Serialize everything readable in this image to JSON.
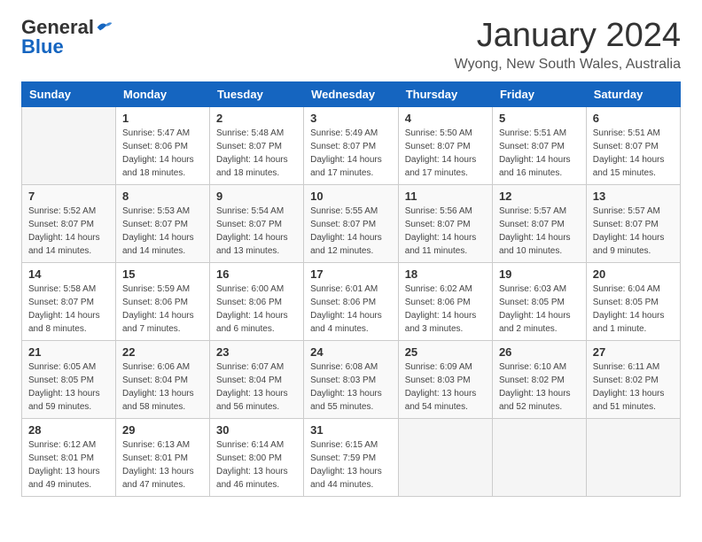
{
  "header": {
    "logo_general": "General",
    "logo_blue": "Blue",
    "month_title": "January 2024",
    "location": "Wyong, New South Wales, Australia"
  },
  "weekdays": [
    "Sunday",
    "Monday",
    "Tuesday",
    "Wednesday",
    "Thursday",
    "Friday",
    "Saturday"
  ],
  "weeks": [
    [
      {
        "day": "",
        "info": ""
      },
      {
        "day": "1",
        "info": "Sunrise: 5:47 AM\nSunset: 8:06 PM\nDaylight: 14 hours\nand 18 minutes."
      },
      {
        "day": "2",
        "info": "Sunrise: 5:48 AM\nSunset: 8:07 PM\nDaylight: 14 hours\nand 18 minutes."
      },
      {
        "day": "3",
        "info": "Sunrise: 5:49 AM\nSunset: 8:07 PM\nDaylight: 14 hours\nand 17 minutes."
      },
      {
        "day": "4",
        "info": "Sunrise: 5:50 AM\nSunset: 8:07 PM\nDaylight: 14 hours\nand 17 minutes."
      },
      {
        "day": "5",
        "info": "Sunrise: 5:51 AM\nSunset: 8:07 PM\nDaylight: 14 hours\nand 16 minutes."
      },
      {
        "day": "6",
        "info": "Sunrise: 5:51 AM\nSunset: 8:07 PM\nDaylight: 14 hours\nand 15 minutes."
      }
    ],
    [
      {
        "day": "7",
        "info": "Sunrise: 5:52 AM\nSunset: 8:07 PM\nDaylight: 14 hours\nand 14 minutes."
      },
      {
        "day": "8",
        "info": "Sunrise: 5:53 AM\nSunset: 8:07 PM\nDaylight: 14 hours\nand 14 minutes."
      },
      {
        "day": "9",
        "info": "Sunrise: 5:54 AM\nSunset: 8:07 PM\nDaylight: 14 hours\nand 13 minutes."
      },
      {
        "day": "10",
        "info": "Sunrise: 5:55 AM\nSunset: 8:07 PM\nDaylight: 14 hours\nand 12 minutes."
      },
      {
        "day": "11",
        "info": "Sunrise: 5:56 AM\nSunset: 8:07 PM\nDaylight: 14 hours\nand 11 minutes."
      },
      {
        "day": "12",
        "info": "Sunrise: 5:57 AM\nSunset: 8:07 PM\nDaylight: 14 hours\nand 10 minutes."
      },
      {
        "day": "13",
        "info": "Sunrise: 5:57 AM\nSunset: 8:07 PM\nDaylight: 14 hours\nand 9 minutes."
      }
    ],
    [
      {
        "day": "14",
        "info": "Sunrise: 5:58 AM\nSunset: 8:07 PM\nDaylight: 14 hours\nand 8 minutes."
      },
      {
        "day": "15",
        "info": "Sunrise: 5:59 AM\nSunset: 8:06 PM\nDaylight: 14 hours\nand 7 minutes."
      },
      {
        "day": "16",
        "info": "Sunrise: 6:00 AM\nSunset: 8:06 PM\nDaylight: 14 hours\nand 6 minutes."
      },
      {
        "day": "17",
        "info": "Sunrise: 6:01 AM\nSunset: 8:06 PM\nDaylight: 14 hours\nand 4 minutes."
      },
      {
        "day": "18",
        "info": "Sunrise: 6:02 AM\nSunset: 8:06 PM\nDaylight: 14 hours\nand 3 minutes."
      },
      {
        "day": "19",
        "info": "Sunrise: 6:03 AM\nSunset: 8:05 PM\nDaylight: 14 hours\nand 2 minutes."
      },
      {
        "day": "20",
        "info": "Sunrise: 6:04 AM\nSunset: 8:05 PM\nDaylight: 14 hours\nand 1 minute."
      }
    ],
    [
      {
        "day": "21",
        "info": "Sunrise: 6:05 AM\nSunset: 8:05 PM\nDaylight: 13 hours\nand 59 minutes."
      },
      {
        "day": "22",
        "info": "Sunrise: 6:06 AM\nSunset: 8:04 PM\nDaylight: 13 hours\nand 58 minutes."
      },
      {
        "day": "23",
        "info": "Sunrise: 6:07 AM\nSunset: 8:04 PM\nDaylight: 13 hours\nand 56 minutes."
      },
      {
        "day": "24",
        "info": "Sunrise: 6:08 AM\nSunset: 8:03 PM\nDaylight: 13 hours\nand 55 minutes."
      },
      {
        "day": "25",
        "info": "Sunrise: 6:09 AM\nSunset: 8:03 PM\nDaylight: 13 hours\nand 54 minutes."
      },
      {
        "day": "26",
        "info": "Sunrise: 6:10 AM\nSunset: 8:02 PM\nDaylight: 13 hours\nand 52 minutes."
      },
      {
        "day": "27",
        "info": "Sunrise: 6:11 AM\nSunset: 8:02 PM\nDaylight: 13 hours\nand 51 minutes."
      }
    ],
    [
      {
        "day": "28",
        "info": "Sunrise: 6:12 AM\nSunset: 8:01 PM\nDaylight: 13 hours\nand 49 minutes."
      },
      {
        "day": "29",
        "info": "Sunrise: 6:13 AM\nSunset: 8:01 PM\nDaylight: 13 hours\nand 47 minutes."
      },
      {
        "day": "30",
        "info": "Sunrise: 6:14 AM\nSunset: 8:00 PM\nDaylight: 13 hours\nand 46 minutes."
      },
      {
        "day": "31",
        "info": "Sunrise: 6:15 AM\nSunset: 7:59 PM\nDaylight: 13 hours\nand 44 minutes."
      },
      {
        "day": "",
        "info": ""
      },
      {
        "day": "",
        "info": ""
      },
      {
        "day": "",
        "info": ""
      }
    ]
  ]
}
